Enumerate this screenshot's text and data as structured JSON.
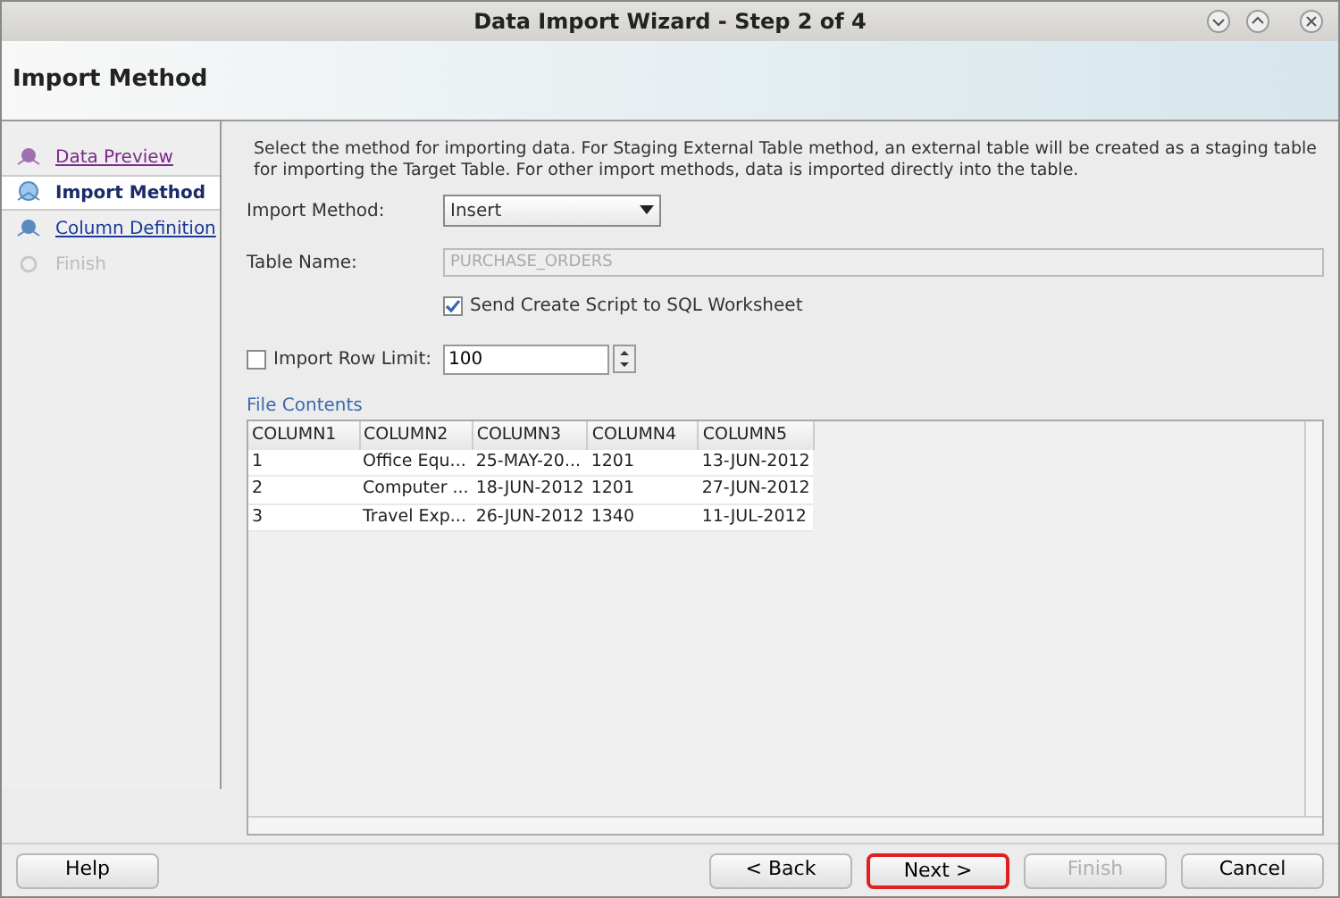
{
  "window": {
    "title": "Data Import Wizard - Step 2 of 4"
  },
  "header": {
    "title": "Import Method"
  },
  "steps": [
    {
      "label": "Data Preview",
      "kind": "visited",
      "selected": false
    },
    {
      "label": "Import Method",
      "kind": "current",
      "selected": true
    },
    {
      "label": "Column Definition",
      "kind": "link",
      "selected": false
    },
    {
      "label": "Finish",
      "kind": "disabled",
      "selected": false
    }
  ],
  "description": "Select the method for importing data.  For Staging External Table method, an external table will be created as a staging table for importing the Target Table.  For other import methods, data is imported directly into the table.",
  "import_method": {
    "label": "Import Method:",
    "value": "Insert"
  },
  "table_name": {
    "label": "Table Name:",
    "value": "PURCHASE_ORDERS",
    "disabled": true
  },
  "send_script": {
    "label": "Send Create Script to SQL Worksheet",
    "checked": true
  },
  "row_limit": {
    "label": "Import Row Limit:",
    "checked": false,
    "value": "100"
  },
  "file_contents": {
    "title": "File Contents",
    "columns": [
      "COLUMN1",
      "COLUMN2",
      "COLUMN3",
      "COLUMN4",
      "COLUMN5"
    ],
    "rows": [
      [
        "1",
        "Office Equ...",
        "25-MAY-20...",
        "1201",
        "13-JUN-2012"
      ],
      [
        "2",
        "Computer ...",
        "18-JUN-2012",
        "1201",
        "27-JUN-2012"
      ],
      [
        "3",
        "Travel Exp...",
        "26-JUN-2012",
        "1340",
        "11-JUL-2012"
      ]
    ]
  },
  "buttons": [
    {
      "label": "Help",
      "disabled": false,
      "focused": false
    },
    {
      "label": "< Back",
      "disabled": false,
      "focused": false
    },
    {
      "label": "Next >",
      "disabled": false,
      "focused": true
    },
    {
      "label": "Finish",
      "disabled": true,
      "focused": false
    },
    {
      "label": "Cancel",
      "disabled": false,
      "focused": false
    }
  ]
}
